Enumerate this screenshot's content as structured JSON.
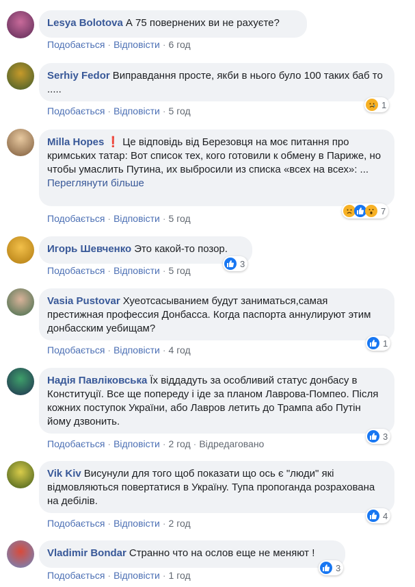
{
  "actions": {
    "like": "Подобається",
    "reply": "Відповісти",
    "edited": "Відредаговано"
  },
  "colors": {
    "link": "#385898",
    "bubble": "#f0f2f5",
    "like": "#1877f2",
    "emoji": "#f7b125"
  },
  "comments": [
    {
      "author": "Lesya Bolotova",
      "text": "А 75 повернених ви не рахуєте?",
      "time": "6 год",
      "reaction_count": ""
    },
    {
      "author": "Serhiy Fedor",
      "text": "Виправдання просте, якби в нього було 100 таких баб то .....",
      "time": "5 год",
      "reaction_count": "1",
      "reactions": [
        "sad-emoji-icon"
      ]
    },
    {
      "author": "Milla Hopes",
      "flag": "❗",
      "text": "Це відповідь від Березовця на моє питання про кримських татар: Вот список тех, кого готовили к обмену в Париже, но чтобы умаслить Путина, их выбросили из списка «всех на всех»: ...",
      "see_more": "Переглянути більше",
      "time": "5 год",
      "reaction_count": "7",
      "reactions": [
        "sad-emoji-icon",
        "like-icon",
        "wow-emoji-icon"
      ]
    },
    {
      "author": "Игорь Шевченко",
      "text": "Это какой-то позор.",
      "time": "5 год",
      "reaction_count": "3",
      "reactions": [
        "like-icon"
      ]
    },
    {
      "author": "Vasia Pustovar",
      "text": "Хуеотсасыванием будут заниматься,самая престижная профессия Донбасса. Когда паспорта аннулируют этим донбасским уебищам?",
      "time": "4 год",
      "reaction_count": "1",
      "reactions": [
        "like-icon"
      ]
    },
    {
      "author": "Надія Павліковська",
      "text": "Їх віддадуть за особливий статус донбасу в Конституції. Все ще попереду і іде за планом Лаврова-Помпео. Після кожних поступок України, або Лавров летить до Трампа або Путін йому дзвонить.",
      "time": "2 год",
      "edited": true,
      "reaction_count": "3",
      "reactions": [
        "like-icon"
      ]
    },
    {
      "author": "Vik Kiv",
      "text": "Висунули для того щоб показати що ось є \"люди\" які відмовляються повертатися в Україну. Тупа пропоганда розрахована на дебілів.",
      "time": "2 год",
      "reaction_count": "4",
      "reactions": [
        "like-icon"
      ]
    },
    {
      "author": "Vladimir Bondar",
      "text": "Странно что на ослов еще не меняют !",
      "time": "1 год",
      "reaction_count": "3",
      "reactions": [
        "like-icon"
      ]
    }
  ]
}
